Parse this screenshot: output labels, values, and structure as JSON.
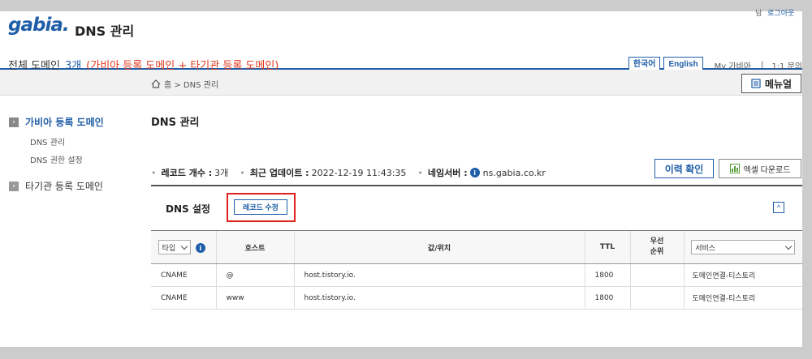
{
  "header": {
    "logo": "gabia.",
    "title": "DNS 관리",
    "user_suffix": "님",
    "logout": "로그아웃"
  },
  "domains": {
    "label": "전체 도메인",
    "count": "3개",
    "note": "(가비아 등록 도메인 + 타기관 등록 도메인)"
  },
  "nav": {
    "korean": "한국어",
    "english": "English",
    "my_gabia": "My 가비아",
    "separator": "|",
    "inquiry": "1:1 문의"
  },
  "breadcrumb": "홈 > DNS 관리",
  "manual_label": "메뉴얼",
  "sidebar": {
    "gabia_section": "가비아 등록 도메인",
    "sub_items": [
      "DNS 관리",
      "DNS 권한 설정"
    ],
    "other_section": "타기관 등록 도메인"
  },
  "page_title": "DNS 관리",
  "summary": {
    "record_label": "레코드 개수 :",
    "record_value": "3개",
    "update_label": "최근 업데이트 :",
    "update_value": "2022-12-19 11:43:35",
    "ns_label": "네임서버 :",
    "ns_value": "ns.gabia.co.kr"
  },
  "buttons": {
    "history": "이력 확인",
    "excel": "엑셀 다운로드",
    "edit_record": "레코드 수정"
  },
  "panel_title": "DNS 설정",
  "table": {
    "type_select": "타입",
    "headers": {
      "host": "호스트",
      "value": "값/위치",
      "ttl": "TTL",
      "priority": "우선 순위",
      "service_select": "서비스"
    },
    "rows": [
      {
        "type": "CNAME",
        "host": "@",
        "value": "host.tistory.io.",
        "ttl": "1800",
        "priority": "",
        "service": "도메인연결-티스토리"
      },
      {
        "type": "CNAME",
        "host": "www",
        "value": "host.tistory.io.",
        "ttl": "1800",
        "priority": "",
        "service": "도메인연결-티스토리"
      }
    ]
  },
  "colors": {
    "accent": "#1f5ea8",
    "highlight": "#e0201c",
    "note": "#e0381c"
  }
}
